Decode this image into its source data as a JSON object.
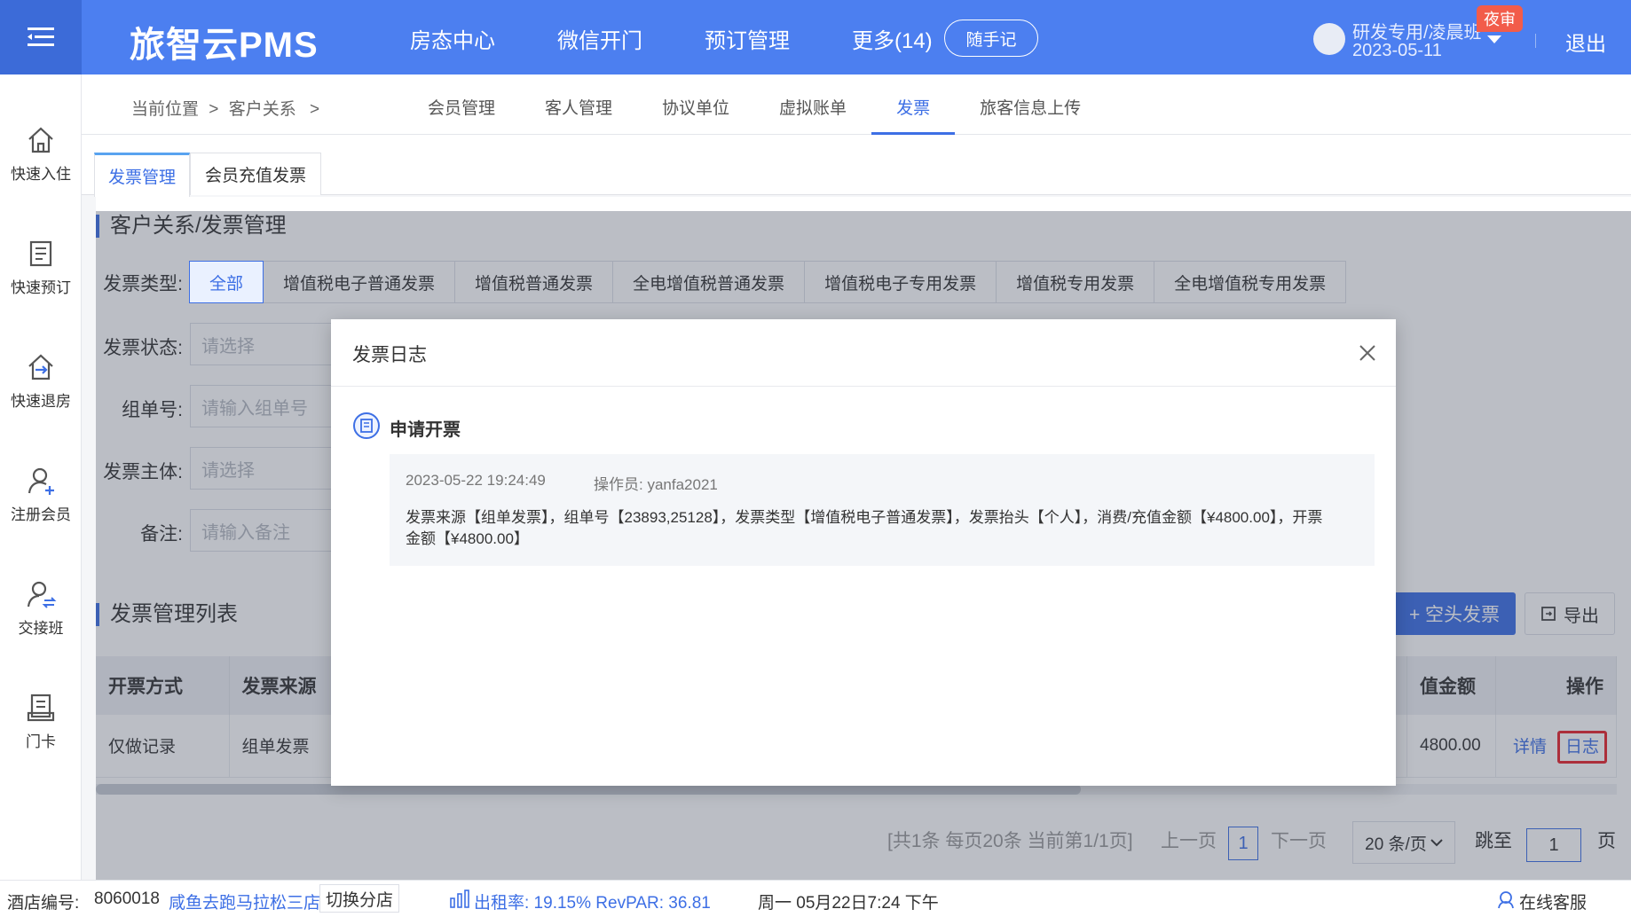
{
  "topbar": {
    "brand": "旅智云PMS",
    "nav": [
      "房态中心",
      "微信开门",
      "预订管理",
      "更多(14)"
    ],
    "memo_button": "随手记",
    "user_name": "研发专用/凌晨班",
    "user_date": "2023-05-11",
    "night_badge": "夜审",
    "logout": "退出"
  },
  "sidebar": {
    "items": [
      {
        "label": "快速入住",
        "icon": "home-icon"
      },
      {
        "label": "快速预订",
        "icon": "booking-icon"
      },
      {
        "label": "快速退房",
        "icon": "checkout-icon"
      },
      {
        "label": "注册会员",
        "icon": "add-member-icon"
      },
      {
        "label": "交接班",
        "icon": "shift-icon"
      },
      {
        "label": "门卡",
        "icon": "card-icon"
      }
    ]
  },
  "breadcrumb": {
    "prefix": "当前位置",
    "sep": ">",
    "section": "客户关系",
    "sep2": ">"
  },
  "subtabs": [
    "会员管理",
    "客人管理",
    "协议单位",
    "虚拟账单",
    "发票",
    "旅客信息上传"
  ],
  "subtab_active": "发票",
  "pagetabs": [
    "发票管理",
    "会员充值发票"
  ],
  "content": {
    "title": "客户关系/发票管理",
    "filters": {
      "type_label": "发票类型:",
      "types": [
        "全部",
        "增值税电子普通发票",
        "增值税普通发票",
        "全电增值税普通发票",
        "增值税电子专用发票",
        "增值税专用发票",
        "全电增值税专用发票"
      ],
      "status_label": "发票状态:",
      "status_placeholder": "请选择",
      "group_label": "组单号:",
      "group_placeholder": "请输入组单号",
      "subject_label": "发票主体:",
      "subject_placeholder": "请选择",
      "remark_label": "备注:",
      "remark_placeholder": "请输入备注"
    },
    "list_title": "发票管理列表",
    "blank_invoice_button": "+ 空头发票",
    "export_button": "导出",
    "table": {
      "headers": [
        "开票方式",
        "发票来源",
        "值金额",
        "操作"
      ],
      "rows": [
        {
          "method": "仅做记录",
          "source": "组单发票",
          "amount": "4800.00",
          "detail": "详情",
          "log": "日志"
        }
      ]
    },
    "pager": {
      "summary": "[共1条 每页20条 当前第1/1页]",
      "prev": "上一页",
      "current": "1",
      "next": "下一页",
      "page_size": "20 条/页",
      "jump_label": "跳至",
      "jump_value": "1",
      "page_unit": "页"
    }
  },
  "modal": {
    "title": "发票日志",
    "entry_title": "申请开票",
    "time": "2023-05-22 19:24:49",
    "operator": "操作员: yanfa2021",
    "text": "发票来源【组单发票】，组单号【23893,25128】，发票类型【增值税电子普通发票】，发票抬头【个人】，消费/充值金额【¥4800.00】，开票金额【¥4800.00】"
  },
  "statusbar": {
    "hotel_no_label": "酒店编号:",
    "hotel_no": "8060018",
    "hotel_name": "咸鱼去跑马拉松三店",
    "switch_store": "切换分店",
    "occupancy": "出租率: 19.15% RevPAR: 36.81",
    "datetime": "周一 05月22日7:24 下午",
    "online_service": "在线客服"
  },
  "colors": {
    "primary": "#4c7ff0",
    "accent": "#3d6fe5",
    "badge": "#f25c4a",
    "highlight": "#e8242b"
  }
}
